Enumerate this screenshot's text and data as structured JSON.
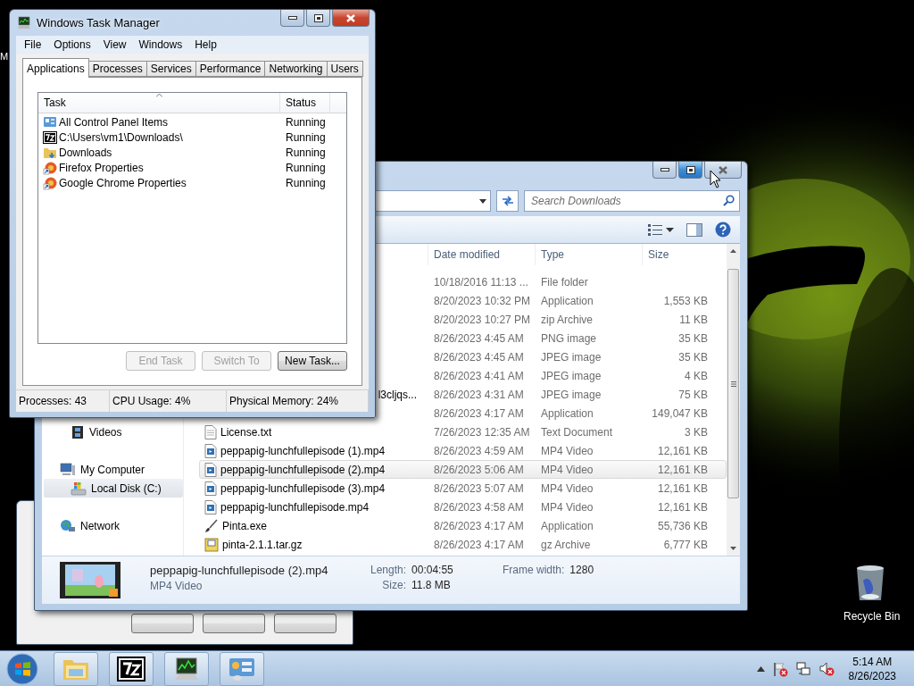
{
  "desktop": {
    "partial_icon_label": "M",
    "recycle_bin": {
      "label": "Recycle Bin"
    }
  },
  "task_manager": {
    "title": "Windows Task Manager",
    "active": true,
    "menu": [
      "File",
      "Options",
      "View",
      "Windows",
      "Help"
    ],
    "tabs": [
      {
        "label": "Applications",
        "selected": true
      },
      {
        "label": "Processes",
        "selected": false
      },
      {
        "label": "Services",
        "selected": false
      },
      {
        "label": "Performance",
        "selected": false
      },
      {
        "label": "Networking",
        "selected": false
      },
      {
        "label": "Users",
        "selected": false
      }
    ],
    "columns": [
      "Task",
      "Status"
    ],
    "tasks": [
      {
        "name": "All Control Panel Items",
        "status": "Running",
        "kind": "controlpanel"
      },
      {
        "name": "C:\\Users\\vm1\\Downloads\\",
        "status": "Running",
        "kind": "sevenzip"
      },
      {
        "name": "Downloads",
        "status": "Running",
        "kind": "folder"
      },
      {
        "name": "Firefox Properties",
        "status": "Running",
        "kind": "shortcut"
      },
      {
        "name": "Google Chrome Properties",
        "status": "Running",
        "kind": "shortcut"
      }
    ],
    "buttons": [
      {
        "label": "End Task",
        "disabled": true
      },
      {
        "label": "Switch To",
        "disabled": true
      },
      {
        "label": "New Task...",
        "disabled": false
      }
    ],
    "status_bar": [
      "Processes: 43",
      "CPU Usage: 4%",
      "Physical Memory: 24%"
    ]
  },
  "explorer": {
    "active": false,
    "window_buttons": [
      {
        "kind": "minimize",
        "hovered": false
      },
      {
        "kind": "maximize",
        "hovered": true
      },
      {
        "kind": "close",
        "hovered": false
      }
    ],
    "search": {
      "placeholder": "Search Downloads"
    },
    "columns": [
      "Date modified",
      "Type",
      "Size"
    ],
    "files": [
      {
        "date": "10/18/2016 11:13 ...",
        "type": "File folder",
        "selected": false
      },
      {
        "date": "8/20/2023 10:32 PM",
        "type": "Application",
        "size": "1,553 KB",
        "selected": false
      },
      {
        "date": "8/20/2023 10:27 PM",
        "type": "zip Archive",
        "size": "11 KB",
        "selected": false
      },
      {
        "date": "8/26/2023 4:45 AM",
        "type": "PNG image",
        "size": "35 KB",
        "selected": false
      },
      {
        "date": "8/26/2023 4:45 AM",
        "type": "JPEG image",
        "size": "35 KB",
        "selected": false
      },
      {
        "date": "8/26/2023 4:41 AM",
        "type": "JPEG image",
        "size": "4 KB",
        "selected": false
      },
      {
        "name_tail": "l3cljqs...",
        "date": "8/26/2023 4:31 AM",
        "type": "JPEG image",
        "size": "75 KB",
        "selected": false
      },
      {
        "date": "8/26/2023 4:17 AM",
        "type": "Application",
        "size": "149,047 KB",
        "selected": false
      },
      {
        "name": "License.txt",
        "kind": "text",
        "date": "7/26/2023 12:35 AM",
        "type": "Text Document",
        "size": "3 KB",
        "selected": false
      },
      {
        "name": "peppapig-lunchfullepisode (1).mp4",
        "kind": "video",
        "date": "8/26/2023 4:59 AM",
        "type": "MP4 Video",
        "size": "12,161 KB",
        "selected": false
      },
      {
        "name": "peppapig-lunchfullepisode (2).mp4",
        "kind": "video",
        "date": "8/26/2023 5:06 AM",
        "type": "MP4 Video",
        "size": "12,161 KB",
        "selected": true
      },
      {
        "name": "peppapig-lunchfullepisode (3).mp4",
        "kind": "video",
        "date": "8/26/2023 5:07 AM",
        "type": "MP4 Video",
        "size": "12,161 KB",
        "selected": false
      },
      {
        "name": "peppapig-lunchfullepisode.mp4",
        "kind": "video",
        "date": "8/26/2023 4:58 AM",
        "type": "MP4 Video",
        "size": "12,161 KB",
        "selected": false
      },
      {
        "name": "Pinta.exe",
        "kind": "brush",
        "date": "8/26/2023 4:17 AM",
        "type": "Application",
        "size": "55,736 KB",
        "selected": false
      },
      {
        "name": "pinta-2.1.1.tar.gz",
        "kind": "archive",
        "date": "8/26/2023 4:17 AM",
        "type": "gz Archive",
        "size": "6,777 KB",
        "selected": false
      }
    ],
    "nav": [
      {
        "children": [
          {
            "label": "Videos",
            "kind": "videos",
            "selected": false
          }
        ]
      },
      {
        "label": "My Computer",
        "kind": "computer",
        "selected": false,
        "children": [
          {
            "label": "Local Disk (C:)",
            "kind": "disk",
            "selected": true
          }
        ]
      },
      {
        "label": "Network",
        "kind": "network",
        "selected": false
      }
    ],
    "details": {
      "name": "peppapig-lunchfullepisode (2).mp4",
      "type": "MP4 Video",
      "fields": [
        {
          "label": "Length:",
          "value": "00:04:55"
        },
        {
          "label": "Size:",
          "value": "11.8 MB"
        },
        {
          "label": "Frame width:",
          "value": "1280"
        }
      ]
    }
  },
  "taskbar": {
    "buttons": [
      {
        "kind": "explorer"
      },
      {
        "kind": "sevenzip"
      },
      {
        "kind": "taskmanager"
      },
      {
        "kind": "controlpanel"
      }
    ],
    "clock": {
      "time": "5:14 AM",
      "date": "8/26/2023"
    }
  }
}
